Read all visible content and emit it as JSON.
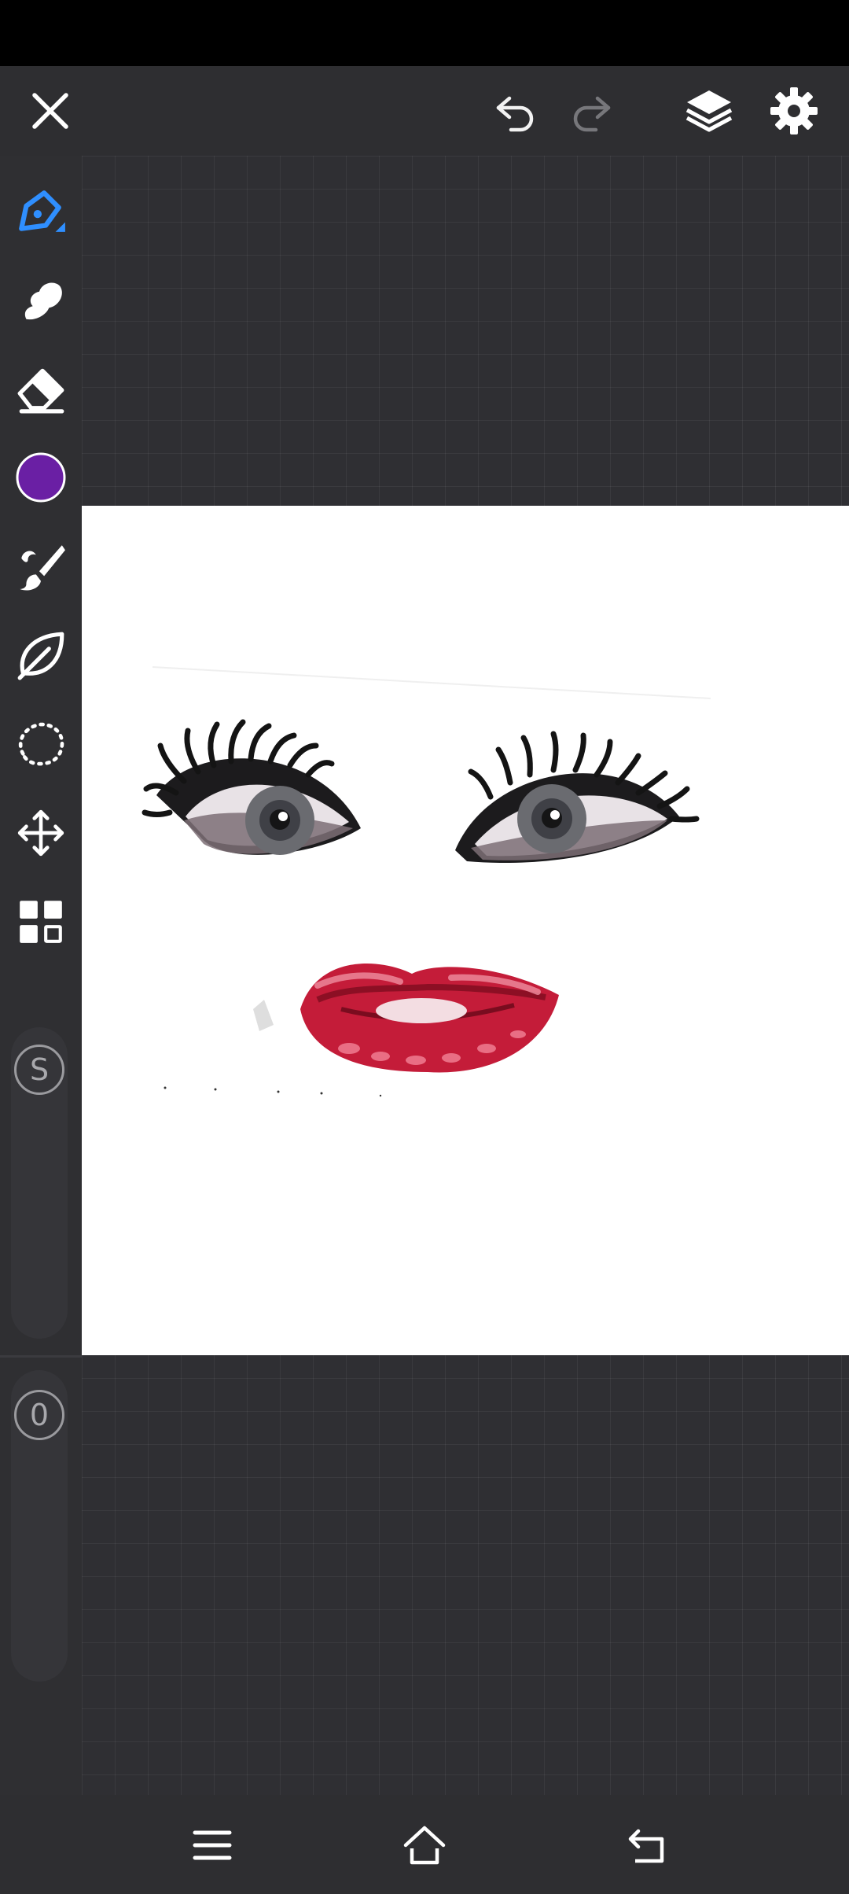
{
  "app": {
    "name": "drawing-app"
  },
  "top_bar": {
    "close_icon": "close-icon",
    "undo_icon": "undo-icon",
    "redo_icon": "redo-icon",
    "redo_enabled": false,
    "layers_icon": "layers-icon",
    "settings_icon": "gear-icon"
  },
  "tools": [
    {
      "id": "pen",
      "icon": "pen-nib-icon",
      "active": true,
      "accent": "#2f8fff"
    },
    {
      "id": "smudge",
      "icon": "smudge-icon",
      "active": false
    },
    {
      "id": "eraser",
      "icon": "eraser-icon",
      "active": false
    },
    {
      "id": "color",
      "icon": "color-swatch",
      "color": "#6a1fa4"
    },
    {
      "id": "brush",
      "icon": "paint-brush-icon",
      "active": false
    },
    {
      "id": "fill",
      "icon": "leaf-fill-icon",
      "active": false
    },
    {
      "id": "selection",
      "icon": "lasso-selection-icon",
      "active": false
    },
    {
      "id": "transform",
      "icon": "move-arrows-icon",
      "active": false
    },
    {
      "id": "more",
      "icon": "grid-tiles-icon",
      "active": false
    }
  ],
  "sliders": {
    "size_label": "S",
    "opacity_label": "0"
  },
  "canvas": {
    "background": "#ffffff",
    "content": [
      "eyes",
      "lips"
    ]
  },
  "nav_bar": {
    "menu_icon": "menu-icon",
    "home_icon": "home-icon",
    "back_icon": "back-icon"
  }
}
